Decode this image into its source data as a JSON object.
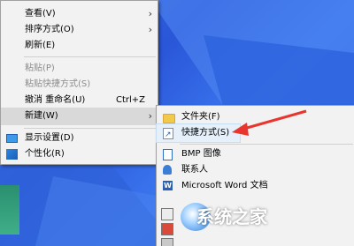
{
  "context_menu": {
    "items": [
      {
        "label": "查看(V)",
        "submenu": true
      },
      {
        "label": "排序方式(O)",
        "submenu": true
      },
      {
        "label": "刷新(E)"
      },
      {
        "label": "粘贴(P)",
        "disabled": true
      },
      {
        "label": "粘贴快捷方式(S)",
        "disabled": true
      },
      {
        "label": "撤消 重命名(U)",
        "shortcut": "Ctrl+Z"
      },
      {
        "label": "新建(W)",
        "submenu": true,
        "highlighted": true
      },
      {
        "label": "显示设置(D)",
        "icon": "monitor-icon"
      },
      {
        "label": "个性化(R)",
        "icon": "personalize-icon"
      }
    ]
  },
  "new_submenu": {
    "items": [
      {
        "label": "文件夹(F)",
        "icon": "folder-icon"
      },
      {
        "label": "快捷方式(S)",
        "icon": "shortcut-icon",
        "hovered": true
      },
      {
        "label": "BMP 图像",
        "icon": "bmp-image-icon"
      },
      {
        "label": "联系人",
        "icon": "contact-icon"
      },
      {
        "label": "Microsoft Word 文档",
        "icon": "word-doc-icon"
      }
    ]
  },
  "watermark": {
    "text": "系统之家"
  },
  "colors": {
    "menu_bg": "#f2f2f2",
    "highlight": "#d9d9d9",
    "annotation_arrow": "#e8362f"
  }
}
